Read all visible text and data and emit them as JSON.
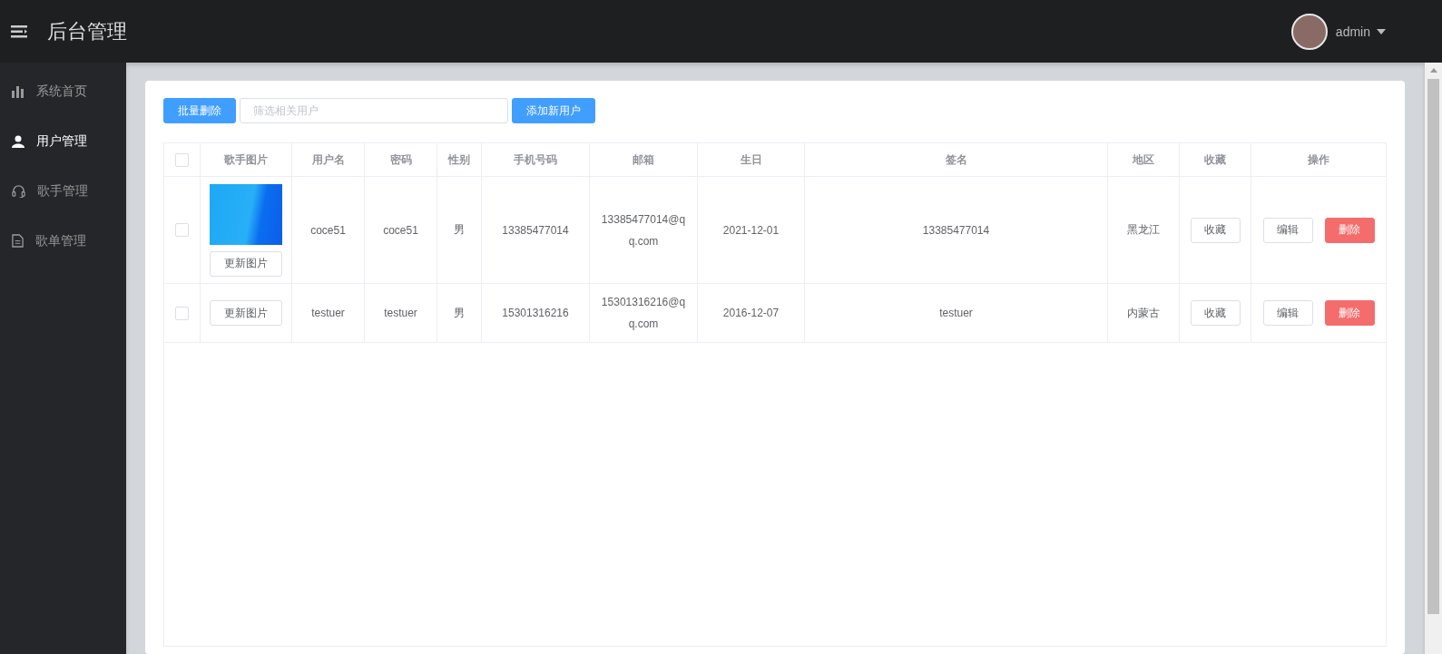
{
  "header": {
    "title": "后台管理",
    "user": "admin"
  },
  "sidebar": {
    "items": [
      {
        "label": "系统首页",
        "kind": "chart",
        "selected": false
      },
      {
        "label": "用户管理",
        "kind": "user",
        "selected": true
      },
      {
        "label": "歌手管理",
        "kind": "headset",
        "selected": false
      },
      {
        "label": "歌单管理",
        "kind": "document",
        "selected": false
      }
    ]
  },
  "toolbar": {
    "delete_button": "批量删除",
    "search": {
      "placeholder": "筛选相关用户"
    },
    "add_button": "添加新用户"
  },
  "table": {
    "columns": [
      "歌手图片",
      "用户名",
      "密码",
      "性别",
      "手机号码",
      "邮箱",
      "生日",
      "签名",
      "地区",
      "收藏",
      "操作"
    ],
    "select_all_checked": false,
    "rows": [
      {
        "checked": false,
        "has_image": true,
        "update_button": "更新图片",
        "username": "coce51",
        "password": "coce51",
        "sex": "男",
        "phone": "13385477014",
        "email": "13385477014@qq.com",
        "birthday": "2021-12-01",
        "signature": "13385477014",
        "region": "黑龙江",
        "favorite_button": "收藏",
        "edit_button": "编辑",
        "delete_button": "删除"
      },
      {
        "checked": false,
        "has_image": false,
        "update_button": "更新图片",
        "username": "testuer",
        "password": "testuer",
        "sex": "男",
        "phone": "15301316216",
        "email": "15301316216@qq.com",
        "birthday": "2016-12-07",
        "signature": "testuer",
        "region": "内蒙古",
        "favorite_button": "收藏",
        "edit_button": "编辑",
        "delete_button": "删除"
      }
    ]
  }
}
